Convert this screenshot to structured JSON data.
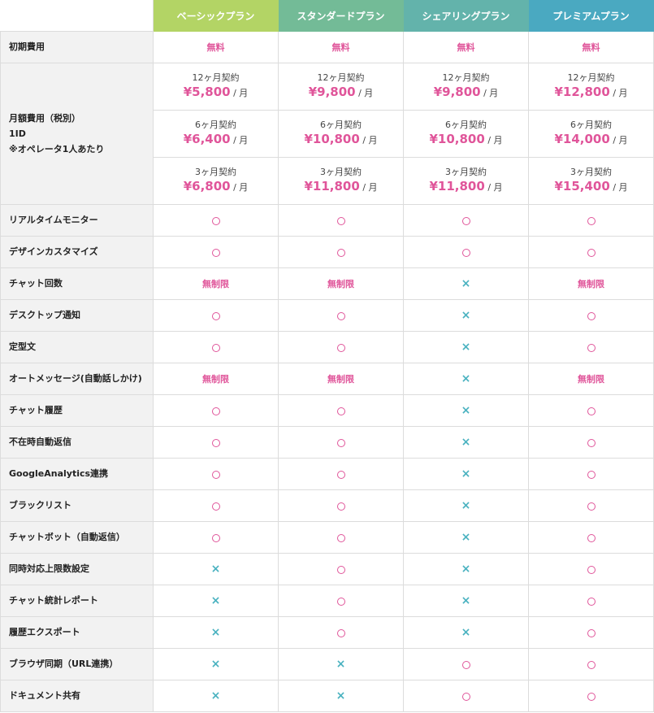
{
  "colors": {
    "pink": "#e0559a",
    "teal": "#4ab2c0",
    "label_bg": "#f2f2f2"
  },
  "plans": [
    {
      "name": "ベーシックプラン",
      "color": "#b3d465"
    },
    {
      "name": "スタンダードプラン",
      "color": "#73bb97"
    },
    {
      "name": "シェアリングプラン",
      "color": "#63b3ab"
    },
    {
      "name": "プレミアムプラン",
      "color": "#4aa9c1"
    }
  ],
  "initial_fee": {
    "label": "初期費用",
    "values": [
      "無料",
      "無料",
      "無料",
      "無料"
    ]
  },
  "monthly": {
    "label_lines": [
      "月額費用（税別）",
      "1ID",
      "※オペレータ1人あたり"
    ],
    "unit": "/ 月",
    "terms": [
      {
        "term": "12ヶ月契約",
        "prices": [
          "¥5,800",
          "¥9,800",
          "¥9,800",
          "¥12,800"
        ]
      },
      {
        "term": "6ヶ月契約",
        "prices": [
          "¥6,400",
          "¥10,800",
          "¥10,800",
          "¥14,000"
        ]
      },
      {
        "term": "3ヶ月契約",
        "prices": [
          "¥6,800",
          "¥11,800",
          "¥11,800",
          "¥15,400"
        ]
      }
    ]
  },
  "legend": {
    "yes": "○",
    "no": "×",
    "unlimited": "無制限"
  },
  "features": [
    {
      "name": "リアルタイムモニター",
      "values": [
        "yes",
        "yes",
        "yes",
        "yes"
      ]
    },
    {
      "name": "デザインカスタマイズ",
      "values": [
        "yes",
        "yes",
        "yes",
        "yes"
      ]
    },
    {
      "name": "チャット回数",
      "values": [
        "unlimited",
        "unlimited",
        "no",
        "unlimited"
      ]
    },
    {
      "name": "デスクトップ通知",
      "values": [
        "yes",
        "yes",
        "no",
        "yes"
      ]
    },
    {
      "name": "定型文",
      "values": [
        "yes",
        "yes",
        "no",
        "yes"
      ]
    },
    {
      "name": "オートメッセージ(自動話しかけ)",
      "values": [
        "unlimited",
        "unlimited",
        "no",
        "unlimited"
      ]
    },
    {
      "name": "チャット履歴",
      "values": [
        "yes",
        "yes",
        "no",
        "yes"
      ]
    },
    {
      "name": "不在時自動返信",
      "values": [
        "yes",
        "yes",
        "no",
        "yes"
      ]
    },
    {
      "name": "GoogleAnalytics連携",
      "values": [
        "yes",
        "yes",
        "no",
        "yes"
      ]
    },
    {
      "name": "ブラックリスト",
      "values": [
        "yes",
        "yes",
        "no",
        "yes"
      ]
    },
    {
      "name": "チャットボット（自動返信）",
      "values": [
        "yes",
        "yes",
        "no",
        "yes"
      ]
    },
    {
      "name": "同時対応上限数設定",
      "values": [
        "no",
        "yes",
        "no",
        "yes"
      ]
    },
    {
      "name": "チャット統計レポート",
      "values": [
        "no",
        "yes",
        "no",
        "yes"
      ]
    },
    {
      "name": "履歴エクスポート",
      "values": [
        "no",
        "yes",
        "no",
        "yes"
      ]
    },
    {
      "name": "ブラウザ同期（URL連携）",
      "values": [
        "no",
        "no",
        "yes",
        "yes"
      ]
    },
    {
      "name": "ドキュメント共有",
      "values": [
        "no",
        "no",
        "yes",
        "yes"
      ]
    }
  ]
}
